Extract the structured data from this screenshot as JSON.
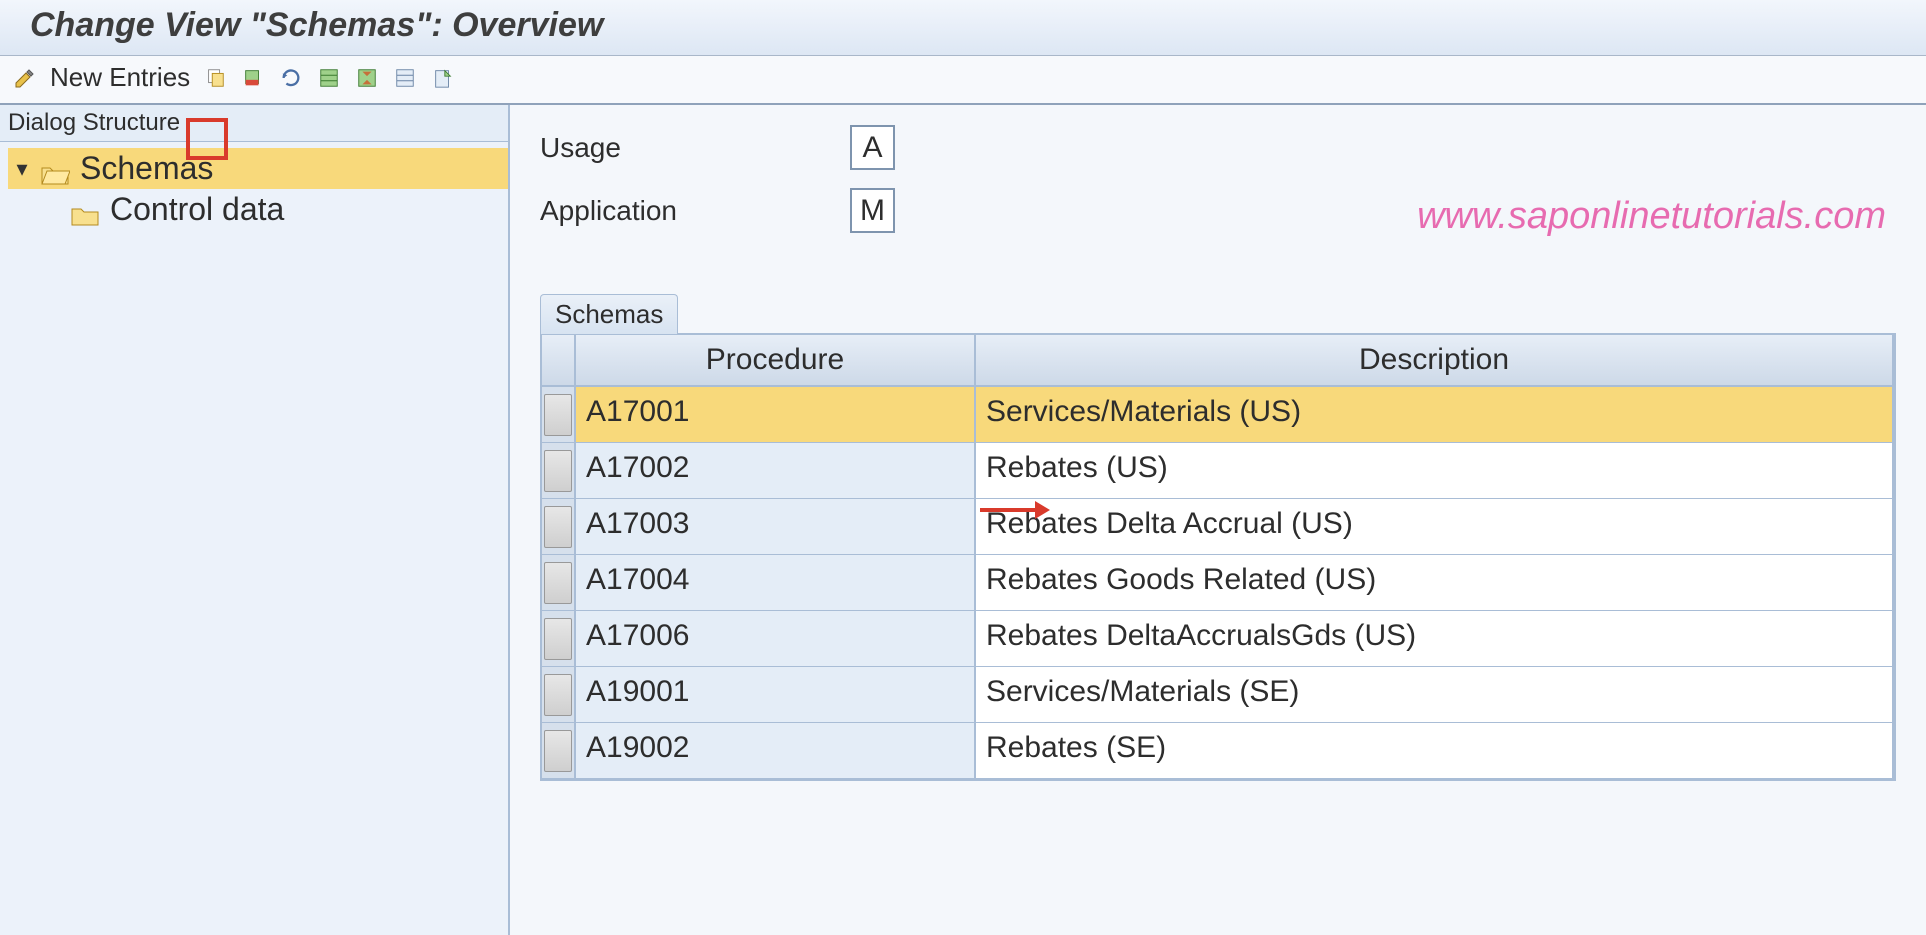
{
  "title": "Change View \"Schemas\": Overview",
  "toolbar": {
    "new_entries": "New Entries"
  },
  "left": {
    "header": "Dialog Structure",
    "node_schemas": "Schemas",
    "node_control": "Control data"
  },
  "right": {
    "usage_label": "Usage",
    "usage_value": "A",
    "application_label": "Application",
    "application_value": "M",
    "watermark": "www.saponlinetutorials.com",
    "panel_title": "Schemas",
    "col_procedure": "Procedure",
    "col_description": "Description",
    "rows": [
      {
        "procedure": "A17001",
        "description": "Services/Materials (US)",
        "selected": true
      },
      {
        "procedure": "A17002",
        "description": "Rebates (US)"
      },
      {
        "procedure": "A17003",
        "description": "Rebates Delta Accrual (US)"
      },
      {
        "procedure": "A17004",
        "description": "Rebates Goods Related (US)"
      },
      {
        "procedure": "A17006",
        "description": "Rebates DeltaAccrualsGds (US)"
      },
      {
        "procedure": "A19001",
        "description": "Services/Materials (SE)"
      },
      {
        "procedure": "A19002",
        "description": "Rebates (SE)"
      }
    ]
  }
}
